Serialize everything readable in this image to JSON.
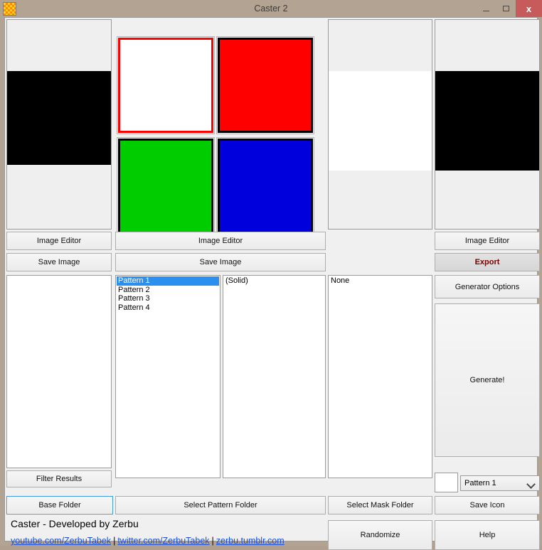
{
  "window": {
    "title": "Caster 2",
    "icon": "checker-pattern-icon",
    "controls": {
      "minimize": "minimize-icon",
      "maximize": "maximize-icon",
      "close": "x"
    },
    "chrome_color": "#b3a392",
    "close_color": "#c75b5b"
  },
  "previews": [
    {
      "name": "base-preview",
      "band_color": "#000000"
    },
    {
      "name": "mask-preview",
      "band_color": "#ffffff"
    },
    {
      "name": "result-preview",
      "band_color": "#000000"
    }
  ],
  "tiles": [
    {
      "name": "tile-white",
      "color": "#ffffff",
      "border": "#ff0000",
      "selected": true
    },
    {
      "name": "tile-red",
      "color": "#ff0000",
      "border": "#000000",
      "selected": false
    },
    {
      "name": "tile-green",
      "color": "#00cc00",
      "border": "#000000",
      "selected": false
    },
    {
      "name": "tile-blue",
      "color": "#0000dd",
      "border": "#000000",
      "selected": false
    }
  ],
  "buttons": {
    "image_editor_1": "Image Editor",
    "save_image_1": "Save Image",
    "image_editor_2": "Image Editor",
    "save_image_2": "Save Image",
    "image_editor_3": "Image Editor",
    "export": "Export",
    "generator_options": "Generator Options",
    "generate": "Generate!",
    "filter_results": "Filter Results",
    "base_folder": "Base Folder",
    "select_pattern_folder": "Select Pattern Folder",
    "select_mask_folder": "Select Mask Folder",
    "save_icon": "Save Icon",
    "randomize": "Randomize",
    "help": "Help"
  },
  "lists": {
    "results": {
      "name": "filter-results-list",
      "items": []
    },
    "patterns": {
      "name": "pattern-list",
      "items": [
        "Pattern 1",
        "Pattern 2",
        "Pattern 3",
        "Pattern 4"
      ],
      "selected_index": 0
    },
    "variants": {
      "name": "variant-list",
      "items": [
        "(Solid)"
      ],
      "selected_index": -1
    },
    "masks": {
      "name": "mask-list",
      "items": [
        "None"
      ],
      "selected_index": -1
    }
  },
  "pattern_combo": {
    "name": "pattern-combo",
    "value": "Pattern 1",
    "swatch_color": "#ffffff",
    "chevron": "chevron-down-icon"
  },
  "footer": {
    "credit": "Caster - Developed by Zerbu",
    "links": [
      {
        "label": "youtube.com/ZerbuTabek"
      },
      {
        "label": "twitter.com/ZerbuTabek"
      },
      {
        "label": "zerbu.tumblr.com"
      }
    ],
    "separator": "|",
    "link_color": "#1a4fd6"
  }
}
